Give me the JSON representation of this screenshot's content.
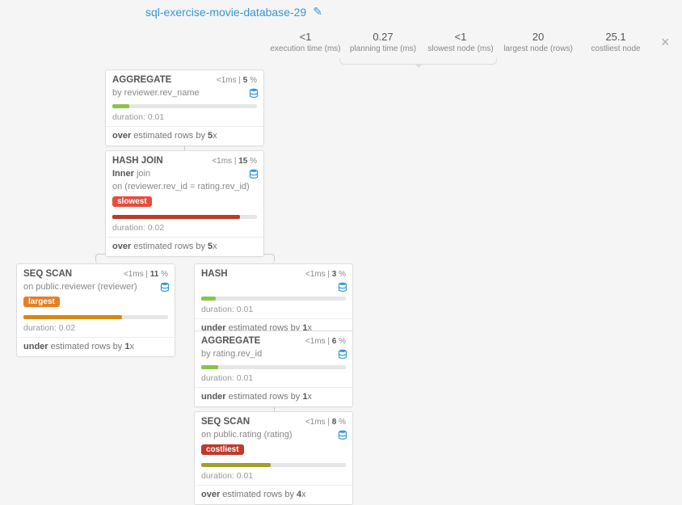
{
  "title": "sql-exercise-movie-database-29",
  "stats": [
    {
      "value": "<1",
      "label": "execution time (ms)"
    },
    {
      "value": "0.27",
      "label": "planning time (ms)"
    },
    {
      "value": "<1",
      "label": "slowest node (ms)"
    },
    {
      "value": "20",
      "label": "largest node (rows)"
    },
    {
      "value": "25.1",
      "label": "costliest node"
    }
  ],
  "nodes": {
    "agg1": {
      "name": "AGGREGATE",
      "time": "<1ms",
      "pct": "5",
      "sub_prefix": "by",
      "sub": " reviewer.rev_name",
      "bar_color": "#8bc34a",
      "bar_pct": 12,
      "duration": "duration: 0.01",
      "est_pre": "over",
      "est_mid": " estimated rows by ",
      "est_x": "5",
      "est_suf": "x"
    },
    "hash_join": {
      "name": "HASH JOIN",
      "time": "<1ms",
      "pct": "15",
      "sub_prefix": "Inner",
      "sub": " join",
      "sub2": "on (reviewer.rev_id = rating.rev_id)",
      "badge": "slowest",
      "badge_cls": "slow",
      "bar_color": "#c0392b",
      "bar_pct": 88,
      "duration": "duration: 0.02",
      "est_pre": "over",
      "est_mid": " estimated rows by ",
      "est_x": "5",
      "est_suf": "x"
    },
    "seq_rev": {
      "name": "SEQ SCAN",
      "time": "<1ms",
      "pct": "11",
      "sub_prefix": "on",
      "sub": " public.reviewer (reviewer)",
      "badge": "largest",
      "badge_cls": "large",
      "bar_color": "#d68910",
      "bar_pct": 68,
      "duration": "duration: 0.02",
      "est_pre": "under",
      "est_mid": " estimated rows by ",
      "est_x": "1",
      "est_suf": "x"
    },
    "hash": {
      "name": "HASH",
      "time": "<1ms",
      "pct": "3",
      "bar_color": "#8bc34a",
      "bar_pct": 10,
      "duration": "duration: 0.01",
      "est_pre": "under",
      "est_mid": " estimated rows by ",
      "est_x": "1",
      "est_suf": "x"
    },
    "agg2": {
      "name": "AGGREGATE",
      "time": "<1ms",
      "pct": "6",
      "sub_prefix": "by",
      "sub": " rating.rev_id",
      "bar_color": "#8bc34a",
      "bar_pct": 12,
      "duration": "duration: 0.01",
      "est_pre": "under",
      "est_mid": " estimated rows by ",
      "est_x": "1",
      "est_suf": "x"
    },
    "seq_rating": {
      "name": "SEQ SCAN",
      "time": "<1ms",
      "pct": "8",
      "sub_prefix": "on",
      "sub": " public.rating (rating)",
      "badge": "costliest",
      "badge_cls": "cost",
      "bar_color": "#a2a029",
      "bar_pct": 48,
      "duration": "duration: 0.01",
      "est_pre": "over",
      "est_mid": " estimated rows by ",
      "est_x": "4",
      "est_suf": "x"
    }
  }
}
